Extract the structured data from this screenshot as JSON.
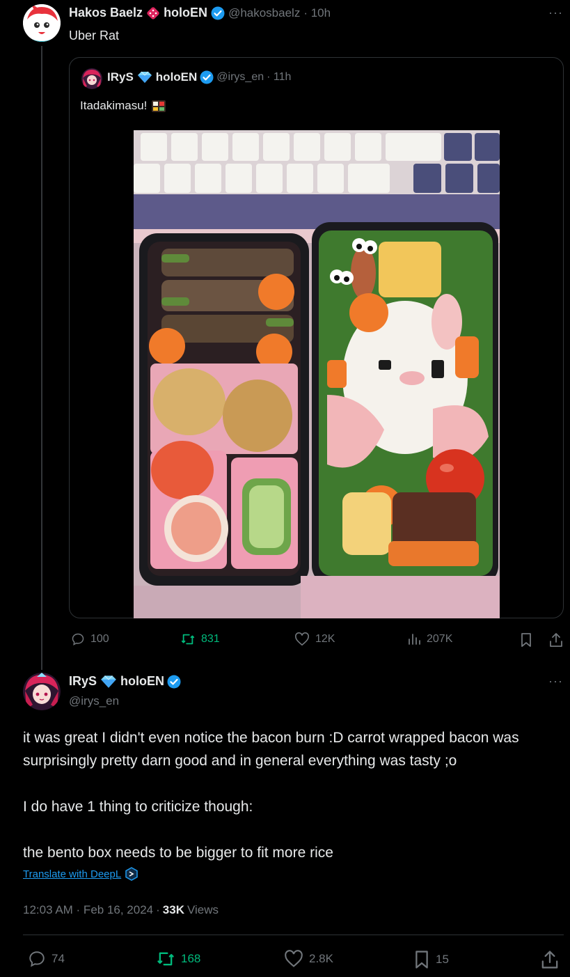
{
  "reply": {
    "author_name": "Hakos Baelz",
    "author_affiliation": "holoEN",
    "handle": "@hakosbaelz",
    "time": "· 10h",
    "text": "Uber Rat",
    "more_icon": "ellipsis-icon"
  },
  "quoted": {
    "author_name": "IRyS",
    "author_affiliation": "holoEN",
    "handle": "@irys_en",
    "time": "· 11h",
    "text": "Itadakimasu!",
    "emoji_icon": "bento-icon",
    "image_alt": "bento boxes photo"
  },
  "reply_actions": {
    "replies": "100",
    "reposts": "831",
    "likes": "12K",
    "views": "207K"
  },
  "main": {
    "author_name": "IRyS",
    "author_affiliation": "holoEN",
    "handle": "@irys_en",
    "paragraphs": [
      "it was great I didn't even notice the bacon burn :D carrot wrapped bacon was surprisingly pretty darn good and in general everything was tasty ;o",
      "I do have 1 thing to criticize though:",
      "the bento box needs to be bigger to fit more rice"
    ],
    "translate": "Translate with DeepL",
    "time": "12:03 AM · Feb 16, 2024",
    "views_count": "33K",
    "views_label": "Views"
  },
  "main_actions": {
    "replies": "74",
    "reposts": "168",
    "likes": "2.8K",
    "bookmarks": "15"
  },
  "colors": {
    "background": "#000000",
    "text": "#e7e9ea",
    "secondary": "#71767b",
    "verified": "#1d9bf0",
    "repost_green": "#00ba7c",
    "link": "#1d9bf0"
  }
}
